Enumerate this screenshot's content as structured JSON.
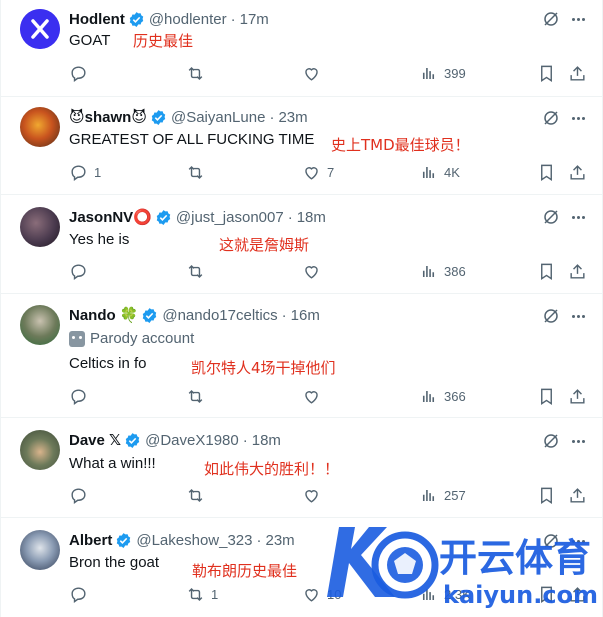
{
  "tweets": [
    {
      "name": "Hodlent",
      "emoji": "",
      "handle": "@hodlenter",
      "time": "17m",
      "parody": "",
      "text": "GOAT",
      "annotation": "历史最佳",
      "replies": "",
      "retweets": "",
      "likes": "",
      "views": "399",
      "avatar_color": "#3b2ff0"
    },
    {
      "name": "shawn",
      "emoji": "😈",
      "handle": "@SaiyanLune",
      "time": "23m",
      "parody": "",
      "text": "GREATEST OF ALL FUCKING TIME",
      "annotation": "史上TMD最佳球员！",
      "replies": "1",
      "retweets": "",
      "likes": "7",
      "views": "4K",
      "avatar_color": "#c8531e"
    },
    {
      "name": "JasonNV",
      "emoji": "⭕",
      "handle": "@just_jason007",
      "time": "18m",
      "parody": "",
      "text": "Yes he is",
      "annotation": "这就是詹姆斯",
      "replies": "",
      "retweets": "",
      "likes": "",
      "views": "386",
      "avatar_color": "#4a3a4e"
    },
    {
      "name": "Nando",
      "emoji": "🍀",
      "handle": "@nando17celtics",
      "time": "16m",
      "parody": "Parody account",
      "text": "Celtics in fo",
      "annotation": "凯尔特人4场干掉他们",
      "replies": "",
      "retweets": "",
      "likes": "",
      "views": "366",
      "avatar_color": "#2f6b3a"
    },
    {
      "name": "Dave 𝕏",
      "emoji": "",
      "handle": "@DaveX1980",
      "time": "18m",
      "parody": "",
      "text": "What a win!!!",
      "annotation": "如此伟大的胜利！！",
      "replies": "",
      "retweets": "",
      "likes": "",
      "views": "257",
      "avatar_color": "#3d4a38"
    },
    {
      "name": "Albert",
      "emoji": "",
      "handle": "@Lakeshow_323",
      "time": "23m",
      "parody": "",
      "text": "Bron the goat",
      "annotation": "勒布朗历史最佳",
      "replies": "",
      "retweets": "1",
      "likes": "10",
      "views": "2.3K",
      "avatar_color": "#5a6d8a"
    }
  ],
  "watermark": {
    "brand": "开云体育",
    "url": "kaiyun.com"
  },
  "colors": {
    "accent": "#1d9bf0",
    "secondary_text": "#536471",
    "annotation": "#e0301e",
    "watermark": "#1a5ce0"
  }
}
